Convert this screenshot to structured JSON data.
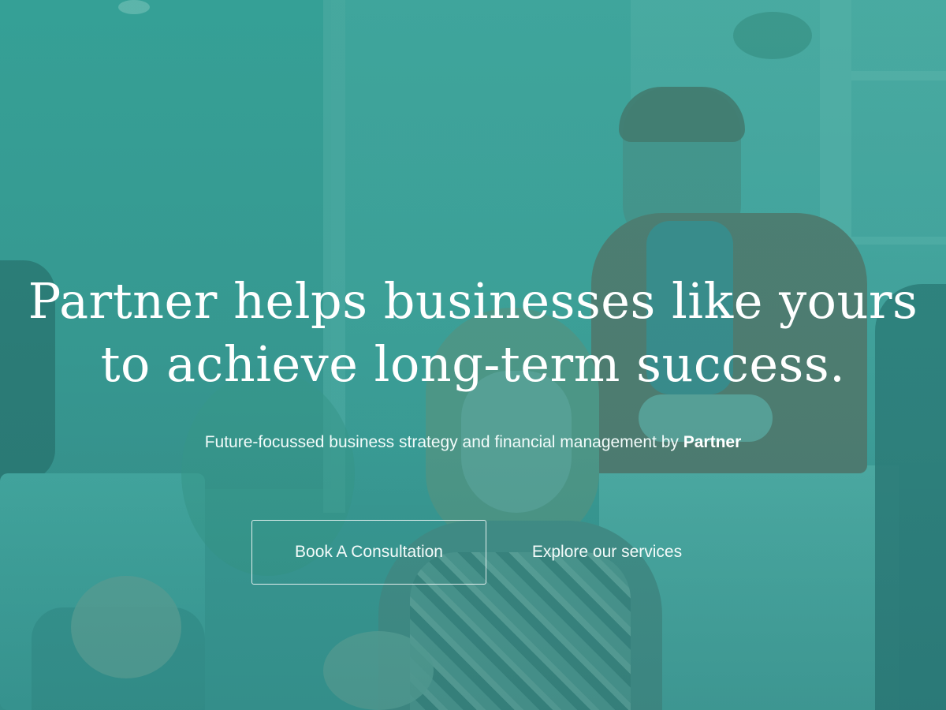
{
  "hero": {
    "headline_line1": "Partner helps businesses like yours",
    "headline_line2": "to achieve long-term success.",
    "subline_text": "Future-focussed business strategy and financial management by ",
    "subline_brand": "Partner",
    "primary_button_label": "Book A Consultation",
    "secondary_link_label": "Explore our services"
  },
  "colors": {
    "overlay_tint": "#2f9a92",
    "text": "#ffffff"
  }
}
